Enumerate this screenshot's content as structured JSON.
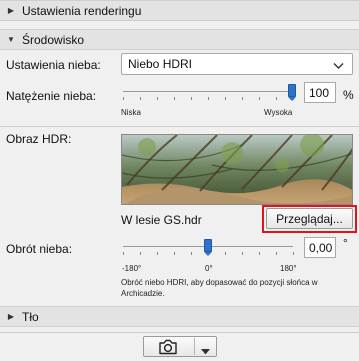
{
  "sections": {
    "rendering": "Ustawienia renderingu",
    "environment": "Środowisko",
    "background": "Tło"
  },
  "sky_settings": {
    "label": "Ustawienia nieba:",
    "value": "Niebo HDRI"
  },
  "sky_intensity": {
    "label": "Natężenie nieba:",
    "value": "100",
    "unit": "%",
    "low_label": "Niska",
    "high_label": "Wysoka",
    "level_fraction": 1.0
  },
  "hdr_image": {
    "label": "Obraz HDR:",
    "filename": "W lesie GS.hdr",
    "browse_label": "Przeglądaj..."
  },
  "sky_rotation": {
    "label": "Obrót nieba:",
    "value": "0,00",
    "unit": "°",
    "min_label": "-180°",
    "mid_label": "0°",
    "max_label": "180°",
    "hint": "Obróć niebo HDRI, aby dopasować do pozycji słońca w Archicadzie."
  },
  "icons": {
    "collapse_right": "triangle-right-icon",
    "expand_down": "triangle-down-icon",
    "dropdown": "chevron-down-icon",
    "camera": "camera-icon",
    "menu_arrow": "triangle-down-icon"
  },
  "colors": {
    "slider_thumb": "#2f73c8",
    "highlight": "#e0141e"
  }
}
